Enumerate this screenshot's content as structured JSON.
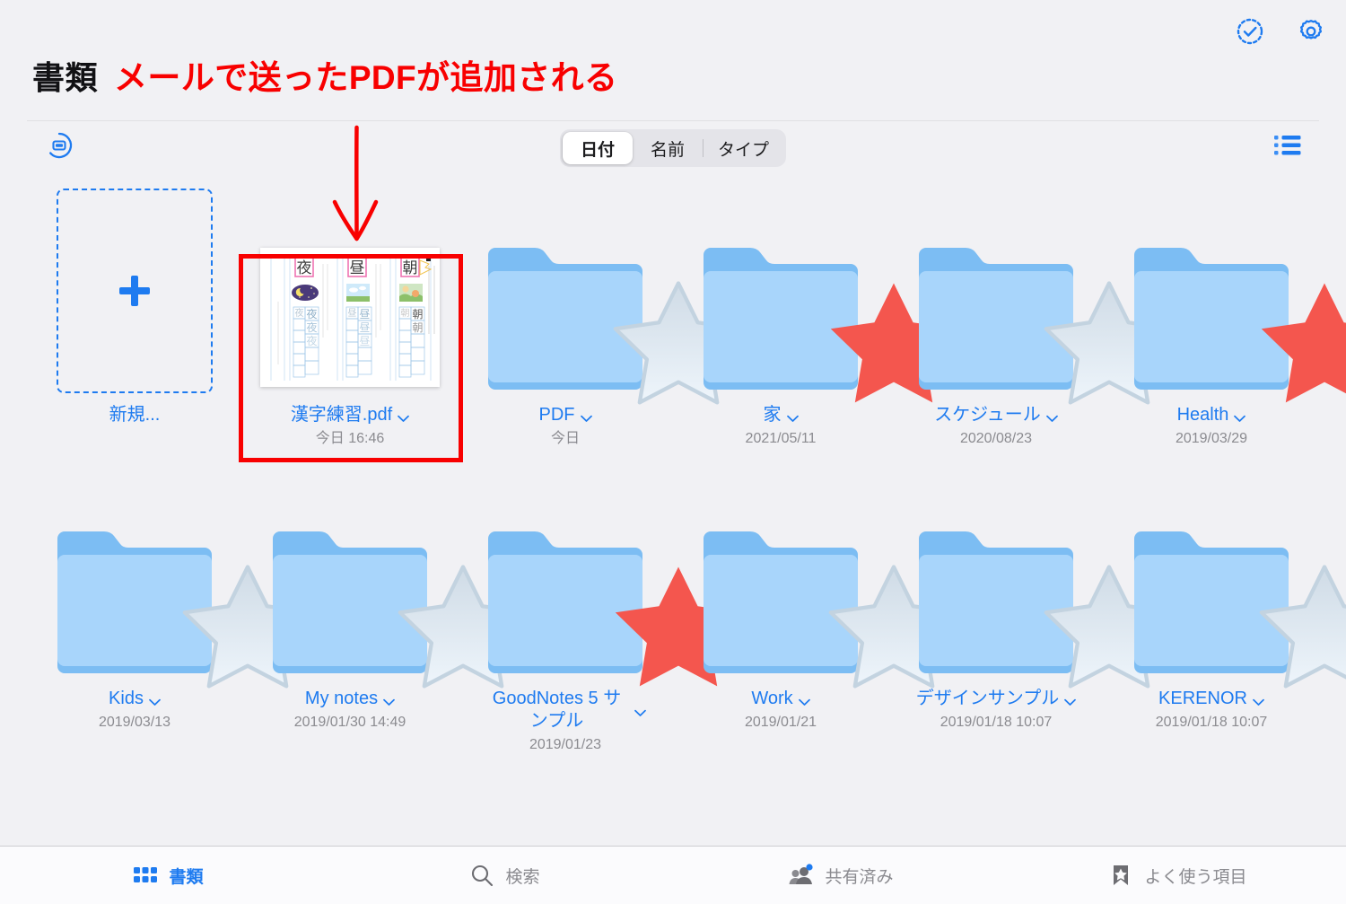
{
  "window": {
    "app": "GoodNotes 5",
    "background": "#f1f1f4"
  },
  "header": {
    "title": "書類",
    "annotation_text": "メールで送ったPDFが追加される",
    "annotation_color": "#f80000",
    "select_icon": "check-circle-dashed-icon",
    "settings_icon": "gear-icon"
  },
  "controls": {
    "left_icon": "document-badge-icon",
    "list_view_icon": "list-view-icon",
    "sort": {
      "options": [
        "日付",
        "名前",
        "タイプ"
      ],
      "selected": "日付"
    }
  },
  "grid": {
    "new_item": {
      "label": "新規...",
      "icon": "plus-icon"
    },
    "items": [
      {
        "name": "漢字練習.pdf",
        "date": "今日 16:46",
        "kind": "pdf",
        "starred": false,
        "highlighted": true,
        "thumbnail": {
          "type": "kanji-practice-worksheet",
          "characters": [
            "夜",
            "昼",
            "朝"
          ]
        }
      },
      {
        "name": "PDF",
        "date": "今日",
        "kind": "folder",
        "starred": false
      },
      {
        "name": "家",
        "date": "2021/05/11",
        "kind": "folder",
        "starred": true
      },
      {
        "name": "スケジュール",
        "date": "2020/08/23",
        "kind": "folder",
        "starred": false
      },
      {
        "name": "Health",
        "date": "2019/03/29",
        "kind": "folder",
        "starred": true
      },
      {
        "name": "Kids",
        "date": "2019/03/13",
        "kind": "folder",
        "starred": false
      },
      {
        "name": "My notes",
        "date": "2019/01/30 14:49",
        "kind": "folder",
        "starred": false
      },
      {
        "name": "GoodNotes 5 サンプル",
        "date": "2019/01/23",
        "kind": "folder",
        "starred": true
      },
      {
        "name": "Work",
        "date": "2019/01/21",
        "kind": "folder",
        "starred": false
      },
      {
        "name": "デザインサンプル",
        "date": "2019/01/18 10:07",
        "kind": "folder",
        "starred": false
      },
      {
        "name": "KERENOR",
        "date": "2019/01/18 10:07",
        "kind": "folder",
        "starred": false
      }
    ]
  },
  "tabbar": {
    "tabs": [
      {
        "label": "書類",
        "icon": "grid-icon",
        "active": true
      },
      {
        "label": "検索",
        "icon": "search-icon",
        "active": false
      },
      {
        "label": "共有済み",
        "icon": "people-icon",
        "active": false,
        "badge": true
      },
      {
        "label": "よく使う項目",
        "icon": "bookmark-star-icon",
        "active": false
      }
    ]
  },
  "colors": {
    "accent": "#1e7bf0",
    "folder_body": "#a8d5fb",
    "folder_tab": "#7cbdf3",
    "star_red": "#f4564e",
    "star_grey": "#d8e4ee",
    "annotation": "#f80000"
  }
}
